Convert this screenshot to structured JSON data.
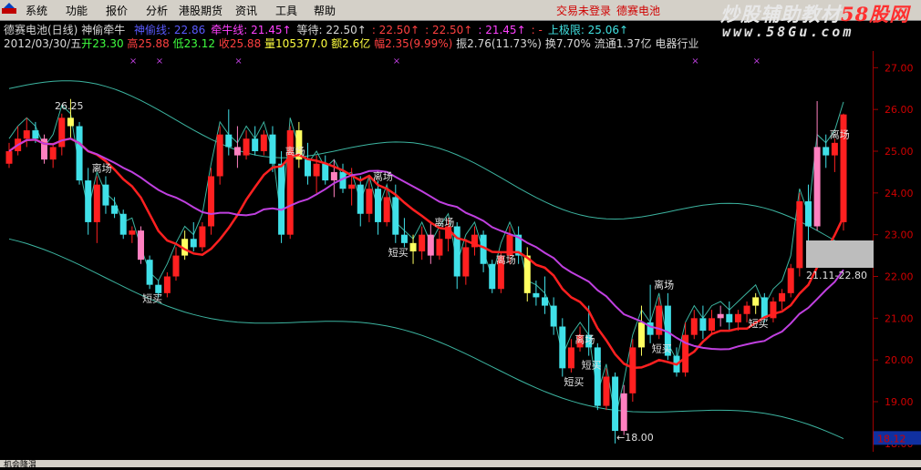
{
  "menu": {
    "items": [
      "系统",
      "功能",
      "报价",
      "分析",
      "港股期货",
      "资讯",
      "工具",
      "帮助"
    ],
    "login_status": "交易未登录",
    "stock_name": "德赛电池"
  },
  "watermark": {
    "line1_prefix": "炒股辅助教材",
    "line1_brand": "58股网",
    "line2": "www.58Gu.com"
  },
  "indicator_bar": {
    "title": "德赛电池(日线)",
    "indicator_name": "神偷牵牛",
    "items": [
      {
        "label": "神偷线:",
        "value": "22.86",
        "color": "#5a5aff"
      },
      {
        "label": "牵牛线:",
        "value": "21.45↑",
        "color": "#ff40ff"
      },
      {
        "label": "等待:",
        "value": "22.50↑",
        "color": "#d8d8d8"
      },
      {
        "label": ":",
        "value": "22.50↑",
        "color": "#ff4040"
      },
      {
        "label": ":",
        "value": "22.50↑",
        "color": "#ff4040"
      },
      {
        "label": ":",
        "value": "21.45↑",
        "color": "#ff40ff"
      },
      {
        "label": ":",
        "value": "-",
        "color": "#ff4040"
      },
      {
        "label": "上极限:",
        "value": "25.06↑",
        "color": "#40e0e0"
      }
    ]
  },
  "quote_bar": {
    "date": "2012/03/30/五",
    "open_label": "开",
    "open": "23.30",
    "high_label": "高",
    "high": "25.88",
    "low_label": "低",
    "low": "23.12",
    "close_label": "收",
    "close": "25.88",
    "volume_label": "量",
    "volume": "105377.0",
    "amount_label": "额",
    "amount": "2.6亿",
    "change_label": "幅",
    "change": "2.35(9.99%)",
    "amplitude_label": "振",
    "amplitude": "2.76(11.73%)",
    "turnover_label": "换",
    "turnover": "7.70%",
    "float_label": "流通",
    "float": "1.37亿",
    "sector": "电器行业"
  },
  "y_axis": {
    "labels": [
      "27.00",
      "26.00",
      "25.00",
      "24.00",
      "23.00",
      "22.00",
      "21.00",
      "20.00",
      "19.00",
      "18.00"
    ],
    "current_price": "18.12"
  },
  "chart_data": {
    "type": "candlestick",
    "ylim": [
      17.8,
      27.4
    ],
    "candles": [
      [
        24.7,
        25.2,
        24.6,
        25.0
      ],
      [
        25.0,
        25.6,
        24.9,
        25.3
      ],
      [
        25.3,
        25.8,
        25.1,
        25.5
      ],
      [
        25.5,
        25.7,
        25.2,
        25.3
      ],
      [
        25.3,
        25.4,
        24.7,
        24.8
      ],
      [
        24.8,
        25.2,
        24.6,
        25.1
      ],
      [
        25.1,
        25.9,
        24.9,
        25.8
      ],
      [
        25.8,
        26.25,
        25.3,
        25.6
      ],
      [
        25.6,
        25.7,
        24.2,
        24.3
      ],
      [
        24.3,
        24.6,
        23.0,
        23.3
      ],
      [
        23.3,
        24.4,
        22.8,
        24.2
      ],
      [
        24.2,
        24.4,
        23.5,
        23.7
      ],
      [
        23.7,
        23.9,
        23.4,
        23.5
      ],
      [
        23.5,
        23.6,
        22.9,
        23.0
      ],
      [
        23.0,
        23.2,
        22.8,
        23.1
      ],
      [
        23.1,
        23.2,
        22.3,
        22.4
      ],
      [
        22.4,
        22.5,
        21.7,
        21.8
      ],
      [
        21.8,
        21.9,
        21.5,
        21.6
      ],
      [
        21.6,
        22.1,
        21.5,
        22.0
      ],
      [
        22.0,
        22.7,
        21.9,
        22.5
      ],
      [
        22.5,
        23.1,
        22.4,
        22.9
      ],
      [
        22.9,
        23.3,
        22.6,
        22.7
      ],
      [
        22.7,
        23.3,
        22.6,
        23.2
      ],
      [
        23.2,
        24.6,
        23.0,
        24.4
      ],
      [
        24.4,
        25.6,
        24.2,
        25.4
      ],
      [
        25.4,
        26.0,
        24.9,
        25.1
      ],
      [
        25.1,
        25.6,
        24.6,
        24.9
      ],
      [
        24.9,
        25.5,
        24.8,
        25.3
      ],
      [
        25.3,
        25.6,
        24.9,
        25.0
      ],
      [
        25.0,
        25.5,
        24.9,
        25.4
      ],
      [
        25.4,
        25.6,
        24.5,
        24.7
      ],
      [
        24.7,
        25.0,
        22.8,
        23.0
      ],
      [
        23.0,
        25.6,
        22.9,
        25.5
      ],
      [
        25.5,
        25.7,
        24.6,
        24.8
      ],
      [
        24.8,
        25.2,
        24.2,
        24.4
      ],
      [
        24.4,
        24.9,
        24.0,
        24.7
      ],
      [
        24.7,
        24.9,
        24.2,
        24.3
      ],
      [
        24.3,
        24.8,
        23.9,
        24.5
      ],
      [
        24.5,
        24.7,
        24.0,
        24.1
      ],
      [
        24.1,
        24.6,
        23.7,
        24.2
      ],
      [
        24.2,
        24.4,
        23.2,
        23.5
      ],
      [
        23.5,
        24.4,
        23.3,
        24.1
      ],
      [
        24.1,
        24.3,
        23.0,
        23.3
      ],
      [
        23.3,
        24.1,
        23.2,
        23.9
      ],
      [
        23.9,
        24.2,
        22.8,
        23.0
      ],
      [
        23.0,
        23.4,
        22.7,
        22.8
      ],
      [
        22.8,
        23.0,
        22.3,
        22.6
      ],
      [
        22.6,
        23.2,
        22.4,
        23.0
      ],
      [
        23.0,
        23.3,
        22.3,
        22.5
      ],
      [
        22.5,
        23.1,
        22.4,
        22.9
      ],
      [
        22.9,
        23.4,
        22.6,
        23.2
      ],
      [
        23.2,
        23.3,
        21.7,
        22.0
      ],
      [
        22.0,
        22.9,
        21.8,
        22.7
      ],
      [
        22.7,
        23.2,
        22.5,
        23.0
      ],
      [
        23.0,
        23.1,
        22.1,
        22.3
      ],
      [
        22.3,
        22.4,
        21.6,
        21.7
      ],
      [
        21.7,
        22.6,
        21.6,
        22.5
      ],
      [
        22.5,
        23.2,
        22.3,
        23.0
      ],
      [
        23.0,
        23.2,
        22.3,
        22.5
      ],
      [
        22.5,
        22.7,
        21.4,
        21.6
      ],
      [
        21.6,
        21.9,
        21.3,
        21.5
      ],
      [
        21.5,
        22.0,
        21.1,
        21.3
      ],
      [
        21.3,
        21.5,
        20.6,
        20.8
      ],
      [
        20.8,
        21.0,
        19.6,
        19.8
      ],
      [
        19.8,
        20.5,
        19.7,
        20.3
      ],
      [
        20.3,
        20.8,
        20.2,
        20.6
      ],
      [
        20.6,
        21.3,
        20.1,
        20.3
      ],
      [
        20.3,
        20.4,
        18.8,
        18.9
      ],
      [
        18.9,
        19.8,
        18.8,
        19.6
      ],
      [
        19.6,
        19.7,
        18.0,
        18.3
      ],
      [
        18.3,
        19.4,
        18.2,
        19.2
      ],
      [
        19.2,
        20.5,
        19.0,
        20.3
      ],
      [
        20.3,
        21.3,
        20.1,
        20.9
      ],
      [
        20.9,
        21.8,
        20.4,
        20.6
      ],
      [
        20.6,
        21.5,
        20.5,
        21.3
      ],
      [
        21.3,
        21.6,
        20.0,
        20.1
      ],
      [
        20.1,
        20.3,
        19.6,
        19.7
      ],
      [
        19.7,
        20.9,
        19.6,
        20.6
      ],
      [
        20.6,
        21.2,
        20.5,
        21.0
      ],
      [
        21.0,
        21.3,
        20.5,
        20.7
      ],
      [
        20.7,
        21.2,
        20.6,
        21.0
      ],
      [
        21.0,
        21.3,
        20.8,
        21.1
      ],
      [
        21.1,
        21.4,
        20.7,
        20.9
      ],
      [
        20.9,
        21.2,
        20.7,
        21.1
      ],
      [
        21.1,
        21.4,
        20.9,
        21.3
      ],
      [
        21.3,
        21.6,
        21.1,
        21.5
      ],
      [
        21.5,
        21.6,
        20.9,
        21.0
      ],
      [
        21.0,
        21.5,
        20.9,
        21.4
      ],
      [
        21.4,
        21.7,
        21.2,
        21.6
      ],
      [
        21.6,
        22.3,
        21.5,
        22.2
      ],
      [
        22.2,
        24.0,
        22.0,
        23.8
      ],
      [
        23.8,
        24.2,
        22.6,
        23.2
      ],
      [
        23.2,
        26.2,
        23.1,
        25.1
      ],
      [
        25.1,
        25.4,
        24.6,
        24.9
      ],
      [
        24.9,
        25.3,
        24.5,
        25.2
      ],
      [
        23.3,
        25.9,
        23.1,
        25.88
      ]
    ],
    "bands": {
      "upper_start": 26.5,
      "upper_end": 22.8,
      "lower_start": 22.5,
      "lower_end": 17.9
    },
    "annotations": [
      {
        "text": "26.25",
        "color": "#e0e0e0"
      },
      {
        "text": "←18.00",
        "color": "#e0e0e0"
      },
      {
        "text": "21.11-22.80",
        "color": "#e0e0e0"
      }
    ],
    "signals": {
      "buy": "短买",
      "exit": "离场"
    }
  },
  "status_bar": {
    "text": "机会降温"
  }
}
